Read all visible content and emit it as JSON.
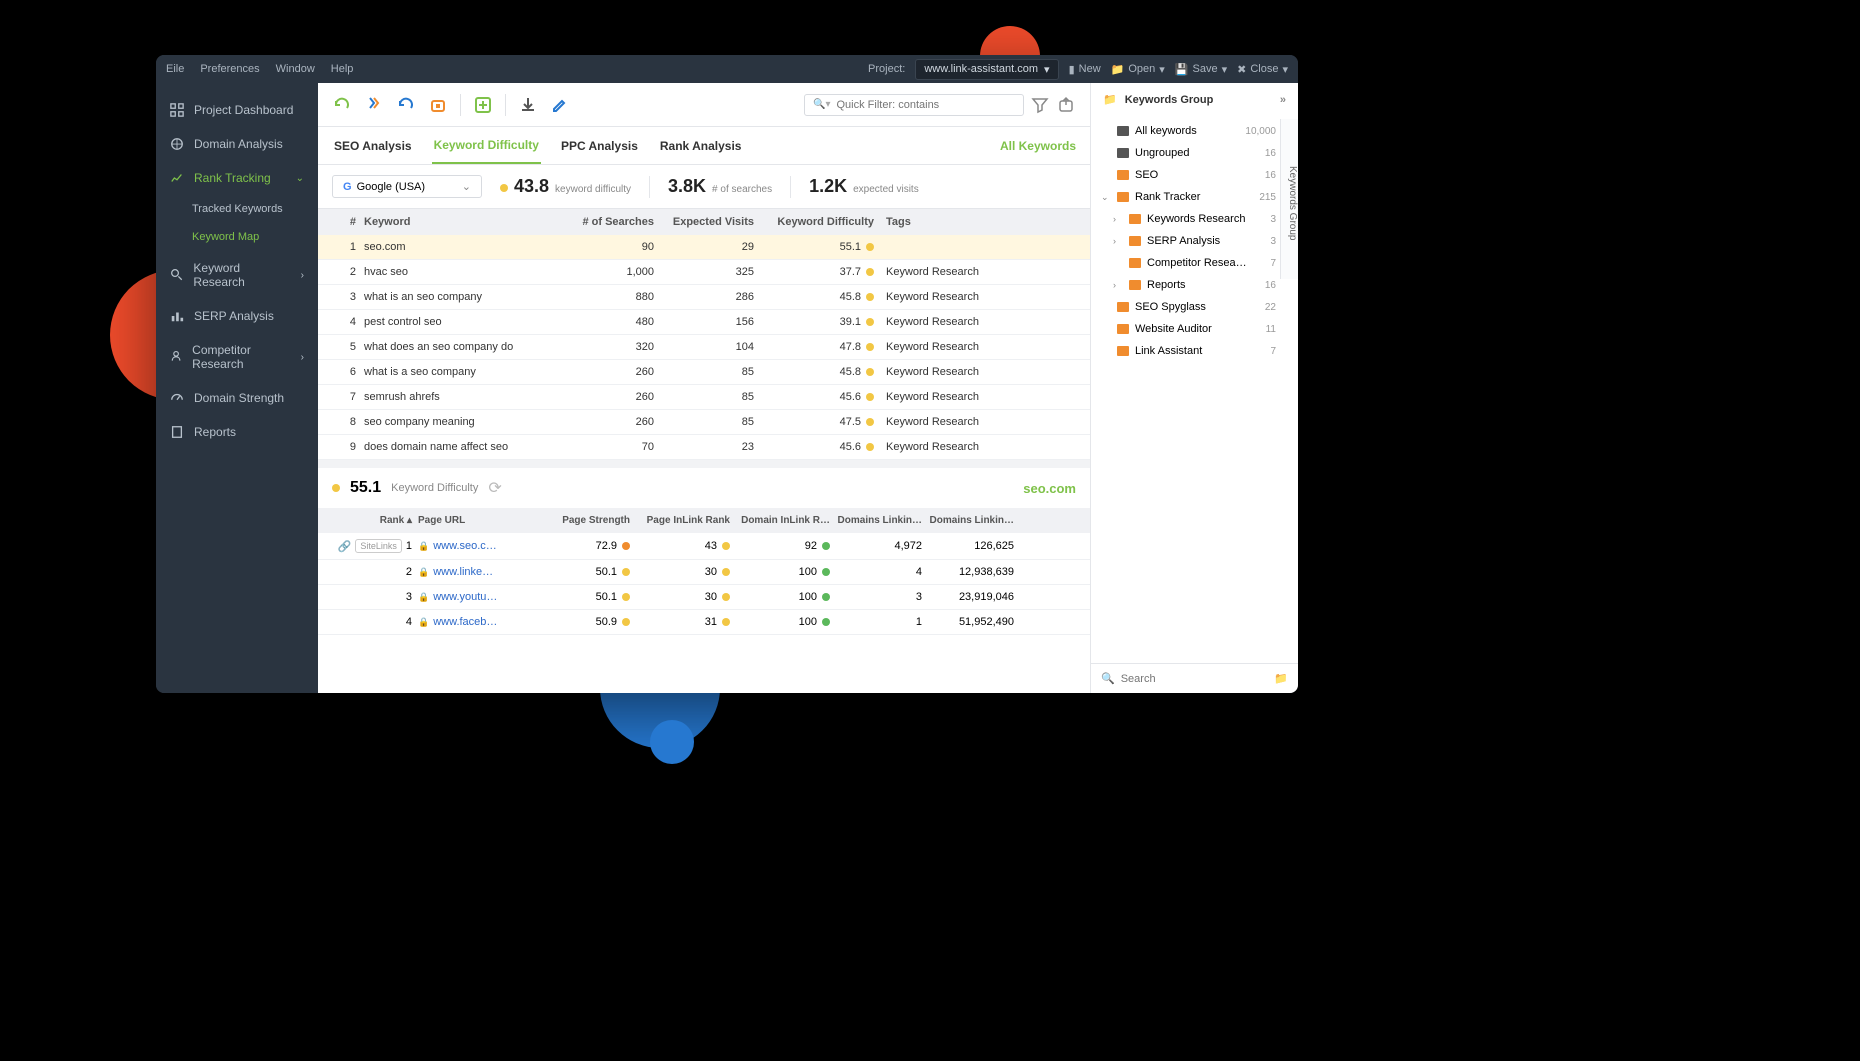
{
  "menu": {
    "file": "Eile",
    "prefs": "Preferences",
    "window": "Window",
    "help": "Help",
    "project_label": "Project:",
    "project": "www.link-assistant.com",
    "new": "New",
    "open": "Open",
    "save": "Save",
    "close": "Close"
  },
  "sidebar": {
    "dashboard": "Project Dashboard",
    "domain_analysis": "Domain Analysis",
    "rank_tracking": "Rank Tracking",
    "tracked_keywords": "Tracked Keywords",
    "keyword_map": "Keyword Map",
    "keyword_research": "Keyword Research",
    "serp_analysis": "SERP Analysis",
    "competitor_research": "Competitor Research",
    "domain_strength": "Domain Strength",
    "reports": "Reports"
  },
  "tabs": {
    "seo": "SEO Analysis",
    "kd": "Keyword Difficulty",
    "ppc": "PPC Analysis",
    "rank": "Rank Analysis",
    "all": "All Keywords"
  },
  "filter": {
    "placeholder": "Quick Filter: contains"
  },
  "se_select": "Google (USA)",
  "stats": {
    "kd": "43.8",
    "kd_lbl": "keyword difficulty",
    "searches": "3.8K",
    "searches_lbl": "# of searches",
    "visits": "1.2K",
    "visits_lbl": "expected visits"
  },
  "columns": {
    "n": "#",
    "kw": "Keyword",
    "searches": "# of Searches",
    "visits": "Expected Visits",
    "kd": "Keyword Difficulty",
    "tags": "Tags"
  },
  "rows": [
    {
      "n": "1",
      "kw": "seo.com",
      "s": "90",
      "v": "29",
      "kd": "55.1",
      "tag": ""
    },
    {
      "n": "2",
      "kw": "hvac seo",
      "s": "1,000",
      "v": "325",
      "kd": "37.7",
      "tag": "Keyword Research"
    },
    {
      "n": "3",
      "kw": "what is an seo company",
      "s": "880",
      "v": "286",
      "kd": "45.8",
      "tag": "Keyword Research"
    },
    {
      "n": "4",
      "kw": "pest control seo",
      "s": "480",
      "v": "156",
      "kd": "39.1",
      "tag": "Keyword Research"
    },
    {
      "n": "5",
      "kw": "what does an seo company do",
      "s": "320",
      "v": "104",
      "kd": "47.8",
      "tag": "Keyword Research"
    },
    {
      "n": "6",
      "kw": "what is a seo company",
      "s": "260",
      "v": "85",
      "kd": "45.8",
      "tag": "Keyword Research"
    },
    {
      "n": "7",
      "kw": "semrush ahrefs",
      "s": "260",
      "v": "85",
      "kd": "45.6",
      "tag": "Keyword Research"
    },
    {
      "n": "8",
      "kw": "seo company meaning",
      "s": "260",
      "v": "85",
      "kd": "47.5",
      "tag": "Keyword Research"
    },
    {
      "n": "9",
      "kw": "does domain name affect seo",
      "s": "70",
      "v": "23",
      "kd": "45.6",
      "tag": "Keyword Research"
    }
  ],
  "detail": {
    "kd": "55.1",
    "kd_lbl": "Keyword Difficulty",
    "domain": "seo.com",
    "cols": {
      "rank": "Rank",
      "url": "Page URL",
      "ps": "Page Strength",
      "pir": "Page InLink Rank",
      "dir": "Domain InLink R…",
      "dli": "Domains Linkin…",
      "dlo": "Domains Linkin…"
    },
    "rows": [
      {
        "rank": "1",
        "url": "www.seo.c…",
        "ps": "72.9",
        "psdot": "orange",
        "pir": "43",
        "dir": "92",
        "dirdot": "green",
        "dli": "4,972",
        "dlo": "126,625",
        "sitelinks": "SiteLinks"
      },
      {
        "rank": "2",
        "url": "www.linke…",
        "ps": "50.1",
        "psdot": "yellow",
        "pir": "30",
        "dir": "100",
        "dirdot": "green",
        "dli": "4",
        "dlo": "12,938,639"
      },
      {
        "rank": "3",
        "url": "www.youtu…",
        "ps": "50.1",
        "psdot": "yellow",
        "pir": "30",
        "dir": "100",
        "dirdot": "green",
        "dli": "3",
        "dlo": "23,919,046"
      },
      {
        "rank": "4",
        "url": "www.faceb…",
        "ps": "50.9",
        "psdot": "yellow",
        "pir": "31",
        "dir": "100",
        "dirdot": "green",
        "dli": "1",
        "dlo": "51,952,490"
      }
    ]
  },
  "panel": {
    "title": "Keywords Group",
    "vtab": "Keywords Group",
    "items": [
      {
        "icon": "dk",
        "label": "All keywords",
        "cnt": "10,000"
      },
      {
        "icon": "dk",
        "label": "Ungrouped",
        "cnt": "16"
      },
      {
        "icon": "or",
        "label": "SEO",
        "cnt": "16"
      },
      {
        "icon": "or",
        "label": "Rank Tracker",
        "cnt": "215",
        "expanded": true,
        "children": [
          {
            "label": "Keywords Research",
            "cnt": "3",
            "exp": true
          },
          {
            "label": "SERP Analysis",
            "cnt": "3",
            "exp": true
          },
          {
            "label": "Competitor Resea…",
            "cnt": "7"
          },
          {
            "label": "Reports",
            "cnt": "16",
            "exp": true
          }
        ]
      },
      {
        "icon": "or",
        "label": "SEO Spyglass",
        "cnt": "22"
      },
      {
        "icon": "or",
        "label": "Website Auditor",
        "cnt": "11"
      },
      {
        "icon": "or",
        "label": "Link Assistant",
        "cnt": "7"
      }
    ],
    "search": "Search"
  }
}
